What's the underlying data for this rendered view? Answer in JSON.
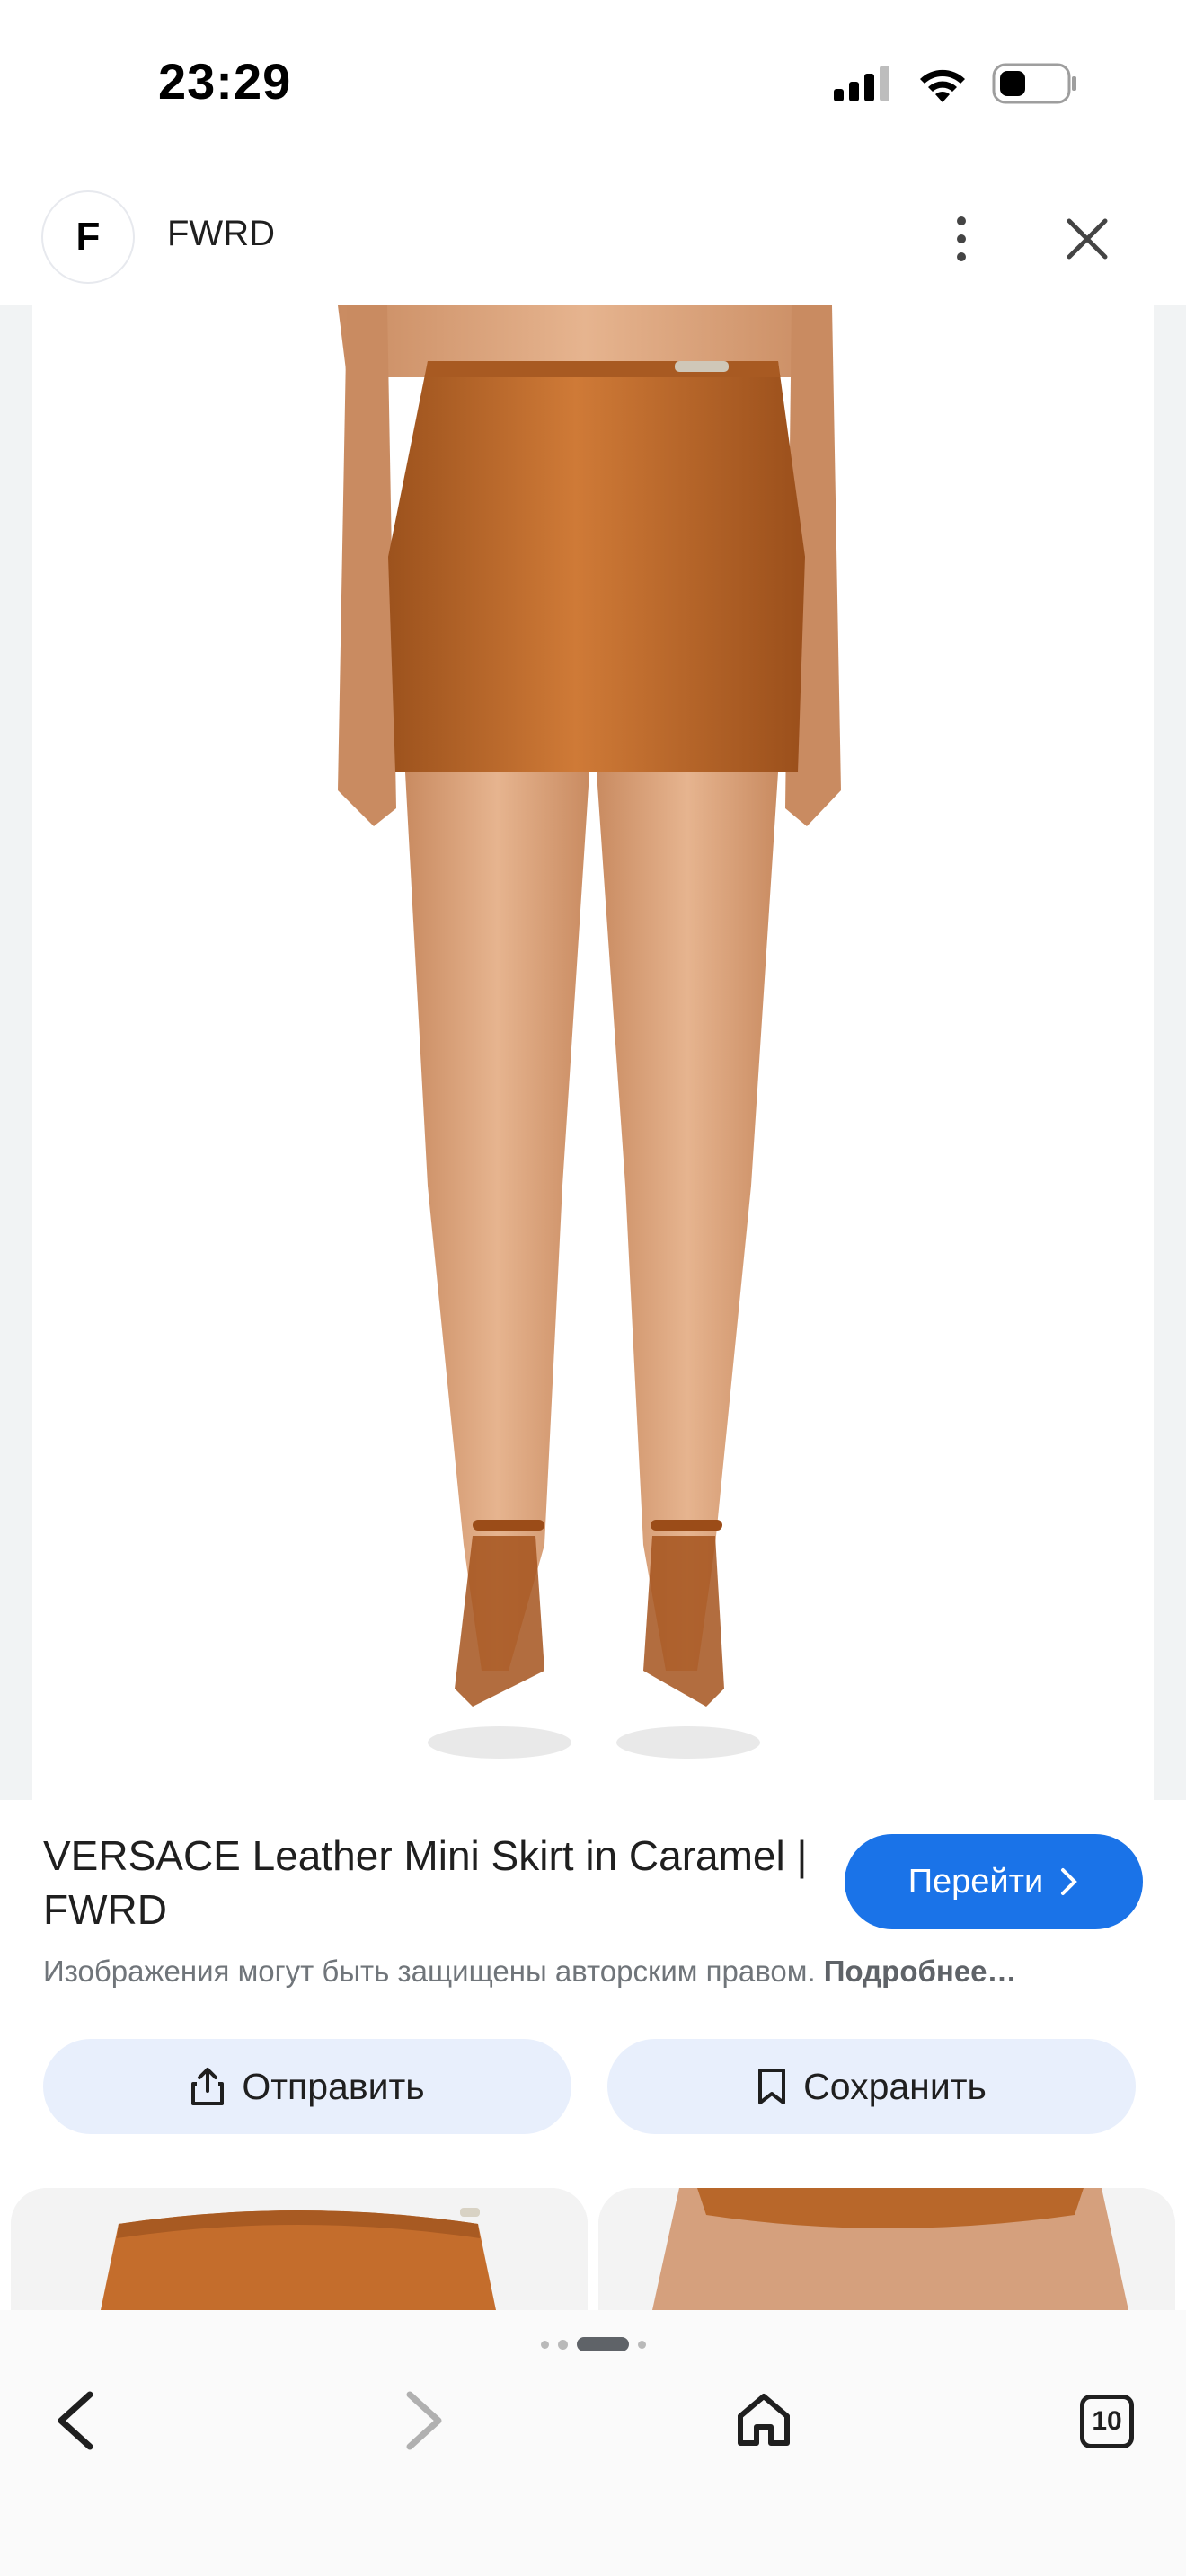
{
  "status_bar": {
    "time": "23:29"
  },
  "header": {
    "site_initial": "F",
    "site_name": "FWRD"
  },
  "result": {
    "title": "VERSACE Leather Mini Skirt in Caramel | FWRD",
    "visit_label": "Перейти",
    "copyright_text": "Изображения могут быть защищены авторским правом.",
    "more_link": "Подробнее…"
  },
  "actions": {
    "share_label": "Отправить",
    "save_label": "Сохранить"
  },
  "browser_nav": {
    "tab_count": "10"
  },
  "colors": {
    "accent": "#1a73e8",
    "pill_bg": "#e8effc",
    "skirt": "#b8672a",
    "skin": "#d9a27a"
  },
  "icons": [
    "cellular-icon",
    "wifi-icon",
    "battery-icon",
    "more-vert-icon",
    "close-icon",
    "chevron-right-icon",
    "share-icon",
    "bookmark-icon",
    "back-icon",
    "forward-icon",
    "home-icon",
    "tabs-icon"
  ]
}
